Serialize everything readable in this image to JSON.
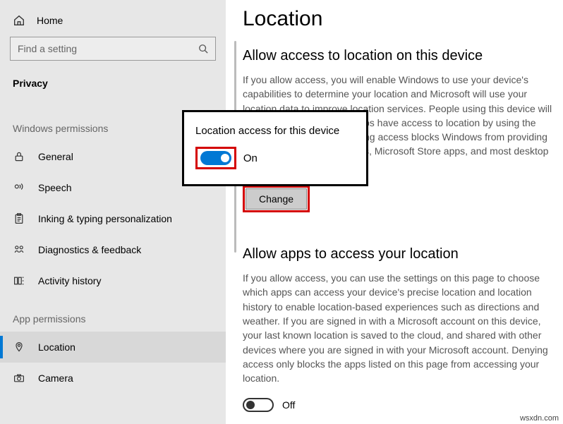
{
  "sidebar": {
    "home_label": "Home",
    "search_placeholder": "Find a setting",
    "category_label": "Privacy",
    "group1_label": "Windows permissions",
    "group2_label": "App permissions",
    "items": {
      "general": "General",
      "speech": "Speech",
      "inking": "Inking & typing personalization",
      "diagnostics": "Diagnostics & feedback",
      "activity": "Activity history",
      "location": "Location",
      "camera": "Camera"
    }
  },
  "main": {
    "page_title": "Location",
    "sec1_title": "Allow access to location on this device",
    "sec1_body": "If you allow access, you will enable Windows to use your device's capabilities to determine your location and Microsoft will use your location data to improve location services. People using this device will be able to choose if their apps have access to location by using the settings on this page. Denying access blocks Windows from providing location to Windows features, Microsoft Store apps, and most desktop apps.",
    "change_label": "Change",
    "sec2_title": "Allow apps to access your location",
    "sec2_body": "If you allow access, you can use the settings on this page to choose which apps can access your device's precise location and location history to enable location-based experiences such as directions and weather. If you are signed in with a Microsoft account on this device, your last known location is saved to the cloud, and shared with other devices where you are signed in with your Microsoft account. Denying access only blocks the apps listed on this page from accessing your location.",
    "toggle_off_label": "Off"
  },
  "popup": {
    "title": "Location access for this device",
    "on_label": "On"
  },
  "watermark": "wsxdn.com"
}
